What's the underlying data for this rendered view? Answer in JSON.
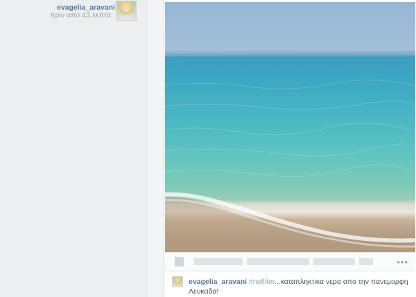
{
  "author": {
    "username": "evagelia_aravani",
    "time_ago": "πριν από 43 λεπτά"
  },
  "post": {
    "photo_icon": "beach-photo",
    "more_options_label": "•••",
    "caption": {
      "username": "evagelia_aravani",
      "hashtag": "#nofilter",
      "text": "...καταπληκτικα νερα απο την πανεμορφη Λευκαδα!"
    }
  }
}
